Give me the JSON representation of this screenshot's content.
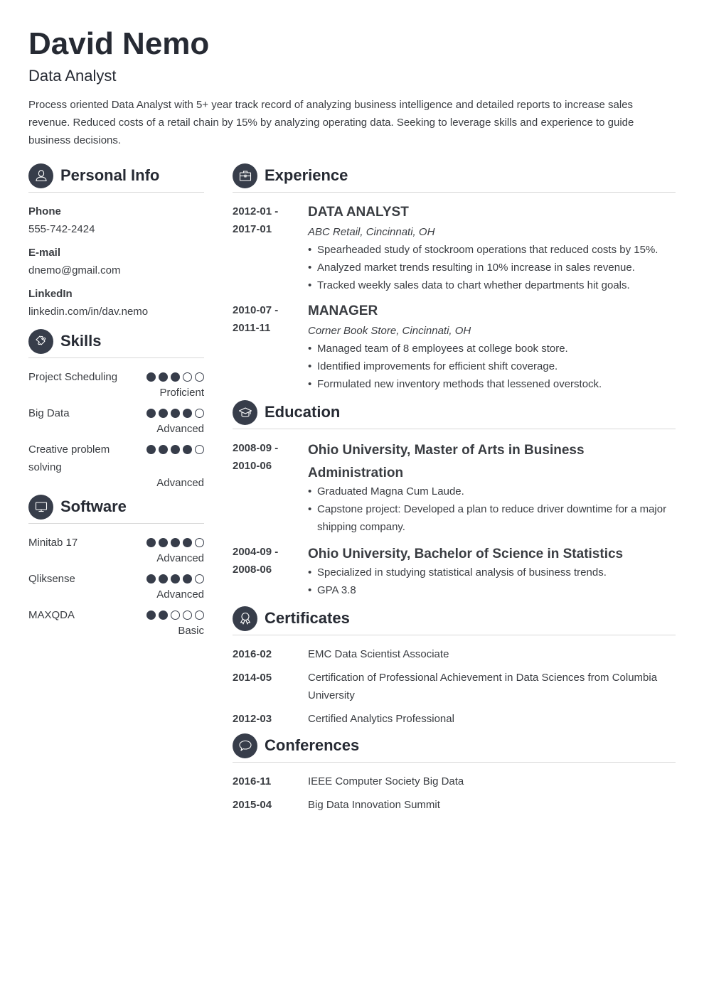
{
  "header": {
    "name": "David Nemo",
    "title": "Data Analyst",
    "summary": "Process oriented Data Analyst with 5+ year track record of analyzing business intelligence and detailed reports to increase sales revenue. Reduced costs of a retail chain by 15% by analyzing operating data. Seeking to leverage skills and experience to guide business decisions."
  },
  "colors": {
    "accent": "#373d4a",
    "text": "#3a3d42",
    "heading": "#262a33",
    "divider": "#d9d9d9"
  },
  "personal_info": {
    "heading": "Personal Info",
    "icon": "person-icon",
    "items": [
      {
        "label": "Phone",
        "value": "555-742-2424"
      },
      {
        "label": "E-mail",
        "value": "dnemo@gmail.com"
      },
      {
        "label": "LinkedIn",
        "value": "linkedin.com/in/dav.nemo"
      }
    ]
  },
  "skills": {
    "heading": "Skills",
    "icon": "puzzle-icon",
    "items": [
      {
        "name": "Project Scheduling",
        "rating": 3,
        "max": 5,
        "level": "Proficient"
      },
      {
        "name": "Big Data",
        "rating": 4,
        "max": 5,
        "level": "Advanced"
      },
      {
        "name": "Creative problem solving",
        "rating": 4,
        "max": 5,
        "level": "Advanced"
      }
    ]
  },
  "software": {
    "heading": "Software",
    "icon": "monitor-icon",
    "items": [
      {
        "name": "Minitab 17",
        "rating": 4,
        "max": 5,
        "level": "Advanced"
      },
      {
        "name": "Qliksense",
        "rating": 4,
        "max": 5,
        "level": "Advanced"
      },
      {
        "name": "MAXQDA",
        "rating": 2,
        "max": 5,
        "level": "Basic"
      }
    ]
  },
  "experience": {
    "heading": "Experience",
    "icon": "briefcase-icon",
    "items": [
      {
        "date_start": "2012-01 -",
        "date_end": "2017-01",
        "title": "DATA ANALYST",
        "company": "ABC Retail, Cincinnati, OH",
        "bullets": [
          "Spearheaded study of stockroom operations that reduced costs by 15%.",
          "Analyzed market trends resulting in 10% increase in sales revenue.",
          "Tracked weekly sales data to chart whether departments hit goals."
        ]
      },
      {
        "date_start": "2010-07 -",
        "date_end": "2011-11",
        "title": "MANAGER",
        "company": "Corner Book Store, Cincinnati, OH",
        "bullets": [
          "Managed team of 8 employees at college book store.",
          "Identified improvements for efficient shift coverage.",
          "Formulated new inventory methods that lessened overstock."
        ]
      }
    ]
  },
  "education": {
    "heading": "Education",
    "icon": "graduation-cap-icon",
    "items": [
      {
        "date_start": "2008-09 -",
        "date_end": "2010-06",
        "title": "Ohio University, Master of Arts in Business Administration",
        "bullets": [
          "Graduated Magna Cum Laude.",
          "Capstone project: Developed a plan to reduce driver downtime for a major shipping company."
        ]
      },
      {
        "date_start": "2004-09 -",
        "date_end": "2008-06",
        "title": "Ohio University, Bachelor of Science in Statistics",
        "bullets": [
          "Specialized in studying statistical analysis of business trends.",
          "GPA 3.8"
        ]
      }
    ]
  },
  "certificates": {
    "heading": "Certificates",
    "icon": "award-ribbon-icon",
    "items": [
      {
        "date": "2016-02",
        "name": "EMC Data Scientist Associate"
      },
      {
        "date": "2014-05",
        "name": "Certification of Professional Achievement in Data Sciences from Columbia University"
      },
      {
        "date": "2012-03",
        "name": "Certified Analytics Professional"
      }
    ]
  },
  "conferences": {
    "heading": "Conferences",
    "icon": "speech-bubble-icon",
    "items": [
      {
        "date": "2016-11",
        "name": "IEEE Computer Society Big Data"
      },
      {
        "date": "2015-04",
        "name": "Big Data Innovation Summit"
      }
    ]
  }
}
